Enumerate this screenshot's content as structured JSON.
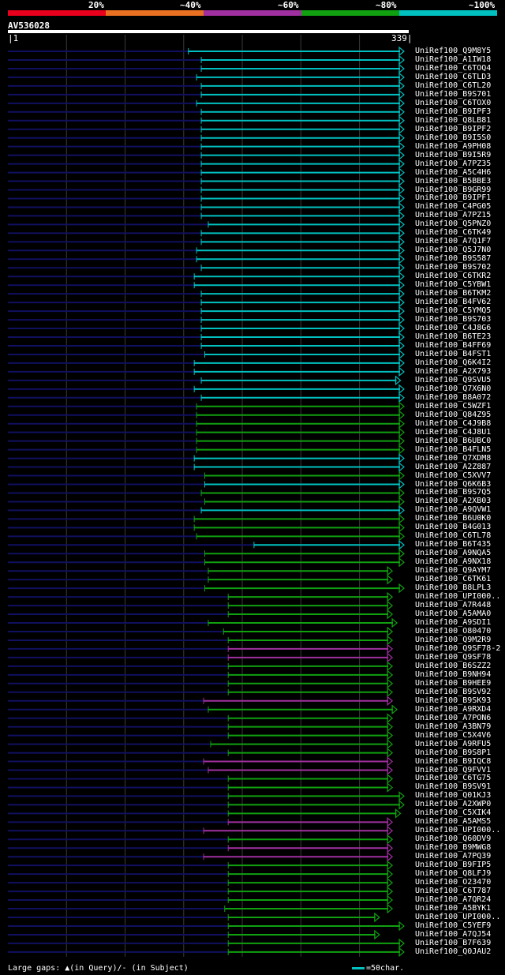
{
  "scale": {
    "labels": [
      "20%",
      "~40%",
      "~60%",
      "~80%",
      "~100%"
    ],
    "colors": [
      "#e8001c",
      "#e87020",
      "#a030a0",
      "#10a010",
      "#00c0c0"
    ]
  },
  "query": {
    "name": "AV536028",
    "start": "1",
    "end": "339",
    "length": 339
  },
  "hits": [
    {
      "name": "UniRef100_Q9M8Y5",
      "start": 155,
      "end": 339,
      "color": "#00c0c0"
    },
    {
      "name": "UniRef100_A1IW18",
      "start": 166,
      "end": 339,
      "color": "#00c0c0"
    },
    {
      "name": "UniRef100_C6TOQ4",
      "start": 166,
      "end": 339,
      "color": "#00c0c0"
    },
    {
      "name": "UniRef100_C6TLD3",
      "start": 162,
      "end": 339,
      "color": "#00c0c0"
    },
    {
      "name": "UniRef100_C6TL20",
      "start": 166,
      "end": 339,
      "color": "#00c0c0"
    },
    {
      "name": "UniRef100_B9S701",
      "start": 166,
      "end": 339,
      "color": "#00c0c0"
    },
    {
      "name": "UniRef100_C6TOX0",
      "start": 162,
      "end": 339,
      "color": "#00c0c0"
    },
    {
      "name": "UniRef100_B9IPF3",
      "start": 166,
      "end": 339,
      "color": "#00c0c0"
    },
    {
      "name": "UniRef100_Q8LB81",
      "start": 166,
      "end": 339,
      "color": "#00c0c0"
    },
    {
      "name": "UniRef100_B9IPF2",
      "start": 166,
      "end": 339,
      "color": "#00c0c0"
    },
    {
      "name": "UniRef100_B9I5S0",
      "start": 166,
      "end": 339,
      "color": "#00c0c0"
    },
    {
      "name": "UniRef100_A9PH08",
      "start": 166,
      "end": 339,
      "color": "#00c0c0"
    },
    {
      "name": "UniRef100_B9I5R9",
      "start": 166,
      "end": 339,
      "color": "#00c0c0"
    },
    {
      "name": "UniRef100_A7PZ35",
      "start": 166,
      "end": 339,
      "color": "#00c0c0"
    },
    {
      "name": "UniRef100_A5C4H6",
      "start": 166,
      "end": 339,
      "color": "#00c0c0"
    },
    {
      "name": "UniRef100_B5BBE3",
      "start": 166,
      "end": 339,
      "color": "#00c0c0"
    },
    {
      "name": "UniRef100_B9GR99",
      "start": 166,
      "end": 339,
      "color": "#00c0c0"
    },
    {
      "name": "UniRef100_B9IPF1",
      "start": 166,
      "end": 339,
      "color": "#00c0c0"
    },
    {
      "name": "UniRef100_C4PG05",
      "start": 166,
      "end": 339,
      "color": "#00c0c0"
    },
    {
      "name": "UniRef100_A7PZ15",
      "start": 166,
      "end": 339,
      "color": "#00c0c0"
    },
    {
      "name": "UniRef100_Q5PNZ0",
      "start": 172,
      "end": 339,
      "color": "#00c0c0"
    },
    {
      "name": "UniRef100_C6TK49",
      "start": 166,
      "end": 339,
      "color": "#00c0c0"
    },
    {
      "name": "UniRef100_A7Q1F7",
      "start": 166,
      "end": 339,
      "color": "#00c0c0"
    },
    {
      "name": "UniRef100_Q5J7N0",
      "start": 162,
      "end": 339,
      "color": "#00c0c0"
    },
    {
      "name": "UniRef100_B9S587",
      "start": 162,
      "end": 339,
      "color": "#00c0c0"
    },
    {
      "name": "UniRef100_B9S702",
      "start": 166,
      "end": 339,
      "color": "#00c0c0"
    },
    {
      "name": "UniRef100_C6TKR2",
      "start": 160,
      "end": 339,
      "color": "#00c0c0"
    },
    {
      "name": "UniRef100_C5YBW1",
      "start": 160,
      "end": 339,
      "color": "#00c0c0"
    },
    {
      "name": "UniRef100_B6TKM2",
      "start": 166,
      "end": 339,
      "color": "#00c0c0"
    },
    {
      "name": "UniRef100_B4FV62",
      "start": 166,
      "end": 339,
      "color": "#00c0c0"
    },
    {
      "name": "UniRef100_C5YMQ5",
      "start": 166,
      "end": 339,
      "color": "#00c0c0"
    },
    {
      "name": "UniRef100_B9S703",
      "start": 166,
      "end": 339,
      "color": "#00c0c0"
    },
    {
      "name": "UniRef100_C4J8G6",
      "start": 166,
      "end": 339,
      "color": "#00c0c0"
    },
    {
      "name": "UniRef100_B6TE23",
      "start": 166,
      "end": 339,
      "color": "#00c0c0"
    },
    {
      "name": "UniRef100_B4FF69",
      "start": 166,
      "end": 339,
      "color": "#00c0c0"
    },
    {
      "name": "UniRef100_B4FST1",
      "start": 169,
      "end": 339,
      "color": "#00c0c0"
    },
    {
      "name": "UniRef100_Q6K4I2",
      "start": 160,
      "end": 339,
      "color": "#00c0c0"
    },
    {
      "name": "UniRef100_A2X793",
      "start": 160,
      "end": 339,
      "color": "#00c0c0"
    },
    {
      "name": "UniRef100_Q9SVU5",
      "start": 166,
      "end": 336,
      "color": "#00c0c0"
    },
    {
      "name": "UniRef100_Q7X6N0",
      "start": 160,
      "end": 339,
      "color": "#00c0c0"
    },
    {
      "name": "UniRef100_B8A072",
      "start": 166,
      "end": 339,
      "color": "#00c0c0"
    },
    {
      "name": "UniRef100_C5WZF1",
      "start": 162,
      "end": 339,
      "color": "#10a010"
    },
    {
      "name": "UniRef100_Q84Z95",
      "start": 162,
      "end": 339,
      "color": "#10a010"
    },
    {
      "name": "UniRef100_C4J9B8",
      "start": 162,
      "end": 339,
      "color": "#10a010"
    },
    {
      "name": "UniRef100_C4J8U1",
      "start": 162,
      "end": 339,
      "color": "#10a010"
    },
    {
      "name": "UniRef100_B6UBC0",
      "start": 162,
      "end": 339,
      "color": "#10a010"
    },
    {
      "name": "UniRef100_B4FLN5",
      "start": 162,
      "end": 339,
      "color": "#10a010"
    },
    {
      "name": "UniRef100_Q7XDM8",
      "start": 160,
      "end": 339,
      "color": "#00c0c0"
    },
    {
      "name": "UniRef100_A2Z887",
      "start": 160,
      "end": 339,
      "color": "#00c0c0"
    },
    {
      "name": "UniRef100_C5XVV7",
      "start": 169,
      "end": 339,
      "color": "#10a010"
    },
    {
      "name": "UniRef100_Q6K6B3",
      "start": 169,
      "end": 339,
      "color": "#00c0c0"
    },
    {
      "name": "UniRef100_B9S7Q5",
      "start": 166,
      "end": 339,
      "color": "#10a010"
    },
    {
      "name": "UniRef100_A2XB03",
      "start": 169,
      "end": 339,
      "color": "#10a010"
    },
    {
      "name": "UniRef100_A9QVW1",
      "start": 166,
      "end": 339,
      "color": "#00c0c0"
    },
    {
      "name": "UniRef100_B6U0K0",
      "start": 160,
      "end": 339,
      "color": "#10a010"
    },
    {
      "name": "UniRef100_B4G013",
      "start": 160,
      "end": 339,
      "color": "#10a010"
    },
    {
      "name": "UniRef100_C6TL78",
      "start": 162,
      "end": 339,
      "color": "#10a010"
    },
    {
      "name": "UniRef100_B6T435",
      "start": 211,
      "end": 339,
      "color": "#00c0c0"
    },
    {
      "name": "UniRef100_A9NQA5",
      "start": 169,
      "end": 339,
      "color": "#10a010"
    },
    {
      "name": "UniRef100_A9NX18",
      "start": 169,
      "end": 339,
      "color": "#10a010"
    },
    {
      "name": "UniRef100_Q9AYM7",
      "start": 172,
      "end": 329,
      "color": "#10a010"
    },
    {
      "name": "UniRef100_C6TK61",
      "start": 172,
      "end": 329,
      "color": "#10a010"
    },
    {
      "name": "UniRef100_B8LPL3",
      "start": 169,
      "end": 339,
      "color": "#10a010"
    },
    {
      "name": "UniRef100_UPI000..",
      "start": 189,
      "end": 329,
      "color": "#10a010"
    },
    {
      "name": "UniRef100_A7R448",
      "start": 189,
      "end": 329,
      "color": "#10a010"
    },
    {
      "name": "UniRef100_A5AMA0",
      "start": 189,
      "end": 329,
      "color": "#10a010"
    },
    {
      "name": "UniRef100_A9SDI1",
      "start": 172,
      "end": 333,
      "color": "#10a010"
    },
    {
      "name": "UniRef100_O80470",
      "start": 185,
      "end": 329,
      "color": "#10a010"
    },
    {
      "name": "UniRef100_Q9M2R9",
      "start": 189,
      "end": 329,
      "color": "#10a010"
    },
    {
      "name": "UniRef100_Q9SF78-2",
      "start": 189,
      "end": 329,
      "color": "#a030a0"
    },
    {
      "name": "UniRef100_Q9SF78",
      "start": 189,
      "end": 329,
      "color": "#a030a0"
    },
    {
      "name": "UniRef100_B6SZZ2",
      "start": 189,
      "end": 329,
      "color": "#10a010"
    },
    {
      "name": "UniRef100_B9NH94",
      "start": 189,
      "end": 329,
      "color": "#10a010"
    },
    {
      "name": "UniRef100_B9HEE9",
      "start": 189,
      "end": 329,
      "color": "#10a010"
    },
    {
      "name": "UniRef100_B9SV92",
      "start": 189,
      "end": 329,
      "color": "#10a010"
    },
    {
      "name": "UniRef100_B9SK93",
      "start": 168,
      "end": 329,
      "color": "#a030a0"
    },
    {
      "name": "UniRef100_A9RXD4",
      "start": 172,
      "end": 333,
      "color": "#10a010"
    },
    {
      "name": "UniRef100_A7PON6",
      "start": 189,
      "end": 329,
      "color": "#10a010"
    },
    {
      "name": "UniRef100_A3BN79",
      "start": 189,
      "end": 329,
      "color": "#10a010"
    },
    {
      "name": "UniRef100_C5X4V6",
      "start": 189,
      "end": 329,
      "color": "#10a010"
    },
    {
      "name": "UniRef100_A9RFU5",
      "start": 174,
      "end": 329,
      "color": "#10a010"
    },
    {
      "name": "UniRef100_B9S8P1",
      "start": 189,
      "end": 329,
      "color": "#10a010"
    },
    {
      "name": "UniRef100_B9IQC8",
      "start": 168,
      "end": 329,
      "color": "#a030a0"
    },
    {
      "name": "UniRef100_Q9FVV1",
      "start": 172,
      "end": 329,
      "color": "#a030a0"
    },
    {
      "name": "UniRef100_C6TG75",
      "start": 189,
      "end": 329,
      "color": "#10a010"
    },
    {
      "name": "UniRef100_B9SV91",
      "start": 189,
      "end": 329,
      "color": "#10a010"
    },
    {
      "name": "UniRef100_Q01KJ3",
      "start": 189,
      "end": 339,
      "color": "#10a010"
    },
    {
      "name": "UniRef100_A2XWP0",
      "start": 189,
      "end": 339,
      "color": "#10a010"
    },
    {
      "name": "UniRef100_C5XIK4",
      "start": 189,
      "end": 336,
      "color": "#10a010"
    },
    {
      "name": "UniRef100_A5AMS5",
      "start": 189,
      "end": 329,
      "color": "#a030a0"
    },
    {
      "name": "UniRef100_UPI000..",
      "start": 168,
      "end": 329,
      "color": "#a030a0"
    },
    {
      "name": "UniRef100_Q60DV9",
      "start": 189,
      "end": 329,
      "color": "#10a010"
    },
    {
      "name": "UniRef100_B9MWG8",
      "start": 189,
      "end": 329,
      "color": "#a030a0"
    },
    {
      "name": "UniRef100_A7PQ39",
      "start": 168,
      "end": 329,
      "color": "#a030a0"
    },
    {
      "name": "UniRef100_B9FIP5",
      "start": 189,
      "end": 329,
      "color": "#10a010"
    },
    {
      "name": "UniRef100_Q8LFJ9",
      "start": 189,
      "end": 329,
      "color": "#10a010"
    },
    {
      "name": "UniRef100_O23470",
      "start": 189,
      "end": 329,
      "color": "#10a010"
    },
    {
      "name": "UniRef100_C6T787",
      "start": 189,
      "end": 329,
      "color": "#10a010"
    },
    {
      "name": "UniRef100_A7QR24",
      "start": 189,
      "end": 329,
      "color": "#10a010"
    },
    {
      "name": "UniRef100_A5BYK1",
      "start": 186,
      "end": 329,
      "color": "#10a010"
    },
    {
      "name": "UniRef100_UPI000..",
      "start": 189,
      "end": 318,
      "color": "#10a010"
    },
    {
      "name": "UniRef100_C5YEF9",
      "start": 189,
      "end": 339,
      "color": "#10a010"
    },
    {
      "name": "UniRef100_A7QJ54",
      "start": 189,
      "end": 318,
      "color": "#10a010"
    },
    {
      "name": "UniRef100_B7F639",
      "start": 189,
      "end": 339,
      "color": "#10a010"
    },
    {
      "name": "UniRef100_Q0JAU2",
      "start": 189,
      "end": 339,
      "color": "#10a010"
    }
  ],
  "footer": {
    "gaps_text": "Large gaps: ▲(in Query)/- (in Subject)",
    "legend_text": "=50char.",
    "legend_color": "#00c0c0"
  }
}
